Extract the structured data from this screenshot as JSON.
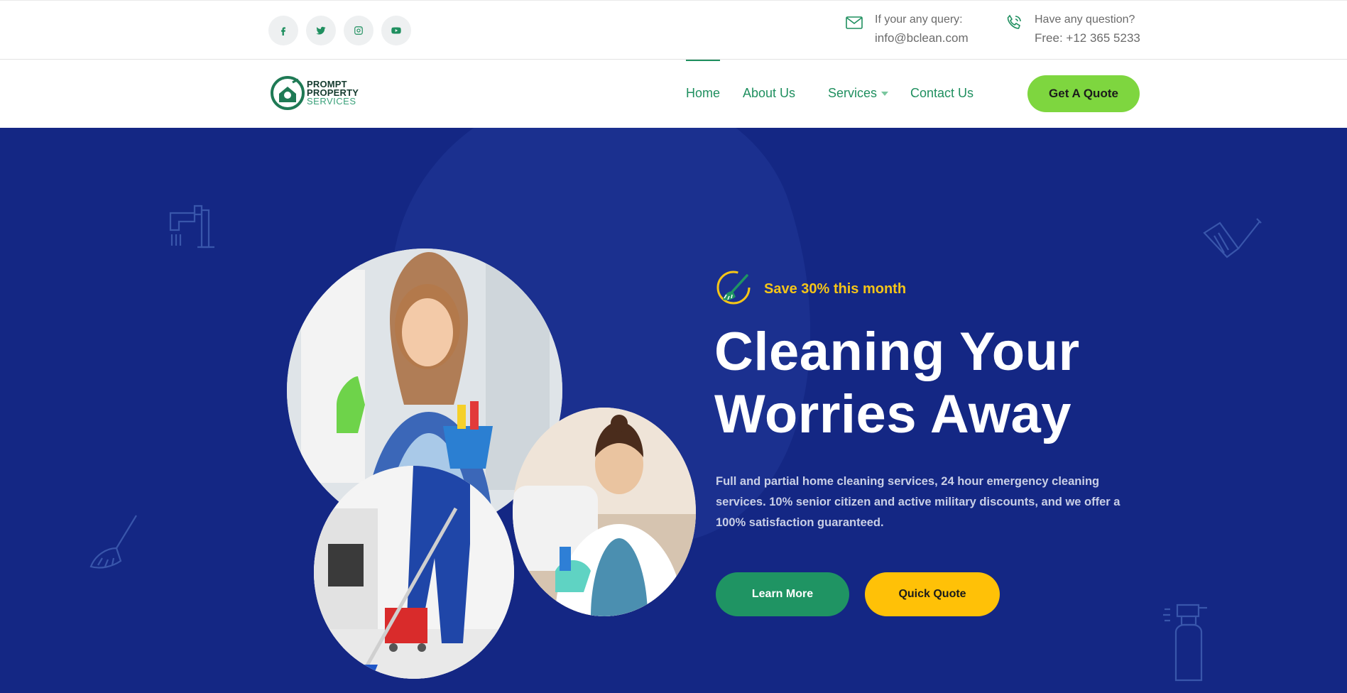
{
  "topbar": {
    "socials": [
      {
        "icon": "facebook-icon"
      },
      {
        "icon": "twitter-icon"
      },
      {
        "icon": "instagram-icon"
      },
      {
        "icon": "youtube-icon"
      }
    ],
    "query_label": "If your any query:",
    "query_value": "info@bclean.com",
    "question_label": "Have any question?",
    "question_value": "Free: +12 365 5233"
  },
  "nav": {
    "logo": {
      "line1": "PROMPT",
      "line2": "PROPERTY",
      "line3": "SERVICES"
    },
    "items": [
      {
        "label": "Home",
        "active": true
      },
      {
        "label": "About Us"
      },
      {
        "label": "Services",
        "dropdown": true
      },
      {
        "label": "Contact Us"
      }
    ],
    "cta": "Get A Quote"
  },
  "hero": {
    "tagline": "Save 30% this month",
    "title_line1": "Cleaning Your",
    "title_line2": "Worries Away",
    "description": "Full and partial home cleaning services, 24 hour emergency cleaning services. 10% senior citizen and active military discounts, and we offer a 100% satisfaction guaranteed.",
    "learn_more": "Learn More",
    "quick_quote": "Quick Quote"
  },
  "colors": {
    "brand_green": "#1f8f5f",
    "cta_green": "#7ed63f",
    "hero_bg": "#142784",
    "accent_yellow": "#ffc107"
  }
}
